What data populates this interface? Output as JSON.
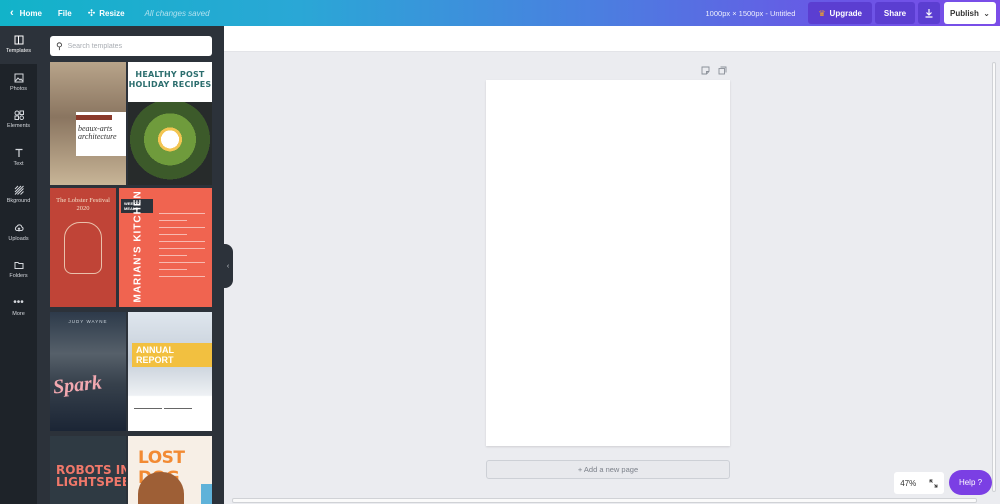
{
  "topbar": {
    "home_label": "Home",
    "file_label": "File",
    "resize_label": "Resize",
    "saved_status": "All changes saved",
    "doc_info": "1000px × 1500px - Untitled",
    "upgrade_label": "Upgrade",
    "share_label": "Share",
    "publish_label": "Publish",
    "gradient_colors": [
      "#12b3c9",
      "#7b4de8"
    ]
  },
  "leftnav": {
    "items": [
      {
        "label": "Templates",
        "icon": "templates-icon"
      },
      {
        "label": "Photos",
        "icon": "photos-icon"
      },
      {
        "label": "Elements",
        "icon": "elements-icon"
      },
      {
        "label": "Text",
        "icon": "text-icon"
      },
      {
        "label": "Bkground",
        "icon": "background-icon"
      },
      {
        "label": "Uploads",
        "icon": "uploads-icon"
      },
      {
        "label": "Folders",
        "icon": "folders-icon"
      },
      {
        "label": "More",
        "icon": "more-icon"
      }
    ]
  },
  "panel": {
    "search_placeholder": "Search templates",
    "templates": [
      {
        "title": "beaux-arts architecture"
      },
      {
        "title": "HEALTHY POST HOLIDAY RECIPES"
      },
      {
        "title": "The Lobster Festival 2020"
      },
      {
        "title": "MARIAN'S KITCHEN",
        "badge": "WEEKLY MEALS"
      },
      {
        "title": "Spark",
        "author": "JUDY WAYNE"
      },
      {
        "title": "ANNUAL REPORT"
      },
      {
        "title": "ROBOTS IN LIGHTSPEED"
      },
      {
        "title": "LOST DOG"
      }
    ]
  },
  "editor": {
    "add_page_label": "+ Add a new page",
    "zoom_label": "47%",
    "help_label": "Help ?"
  },
  "colors": {
    "nav_bg": "#1e2329",
    "panel_bg": "#2c323a",
    "canvas_bg": "#ebecf0",
    "help_purple": "#7b3fe4"
  }
}
